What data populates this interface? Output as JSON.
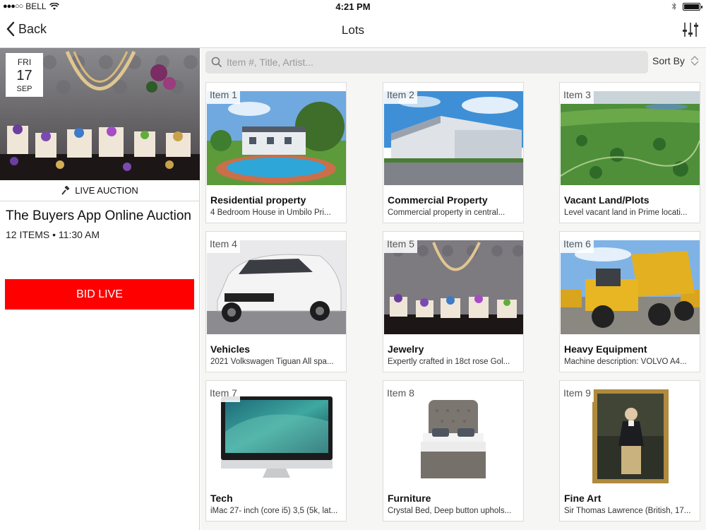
{
  "status": {
    "carrier": "BELL",
    "signal_dots": "●●●○○",
    "time": "4:21 PM"
  },
  "nav": {
    "back_label": "Back",
    "title": "Lots"
  },
  "auction": {
    "date": {
      "dow": "FRI",
      "day": "17",
      "month": "SEP"
    },
    "type_label": "LIVE AUCTION",
    "title": "The Buyers App Online Auction",
    "meta": "12 ITEMS • 11:30 AM",
    "bid_label": "BID LIVE"
  },
  "search": {
    "placeholder": "Item #, Title, Artist..."
  },
  "sort_label": "Sort By",
  "colors": {
    "accent": "#ff0000",
    "panel_bg": "#f6f6f4"
  },
  "lots": [
    {
      "tag": "Item 1",
      "title": "Residential property",
      "desc": "4 Bedroom House in Umbilo Pri..."
    },
    {
      "tag": "Item 2",
      "title": "Commercial Property",
      "desc": "Commercial property in central..."
    },
    {
      "tag": "Item 3",
      "title": "Vacant Land/Plots",
      "desc": "Level vacant land in Prime locati..."
    },
    {
      "tag": "Item 4",
      "title": "Vehicles",
      "desc": "2021 Volkswagen Tiguan All spa..."
    },
    {
      "tag": "Item 5",
      "title": "Jewelry",
      "desc": "Expertly crafted in 18ct rose Gol..."
    },
    {
      "tag": "Item 6",
      "title": "Heavy Equipment",
      "desc": "Machine description: VOLVO A4..."
    },
    {
      "tag": "Item 7",
      "title": "Tech",
      "desc": "iMac 27- inch (core i5) 3,5 (5k, lat..."
    },
    {
      "tag": "Item 8",
      "title": "Furniture",
      "desc": "Crystal Bed, Deep button uphols..."
    },
    {
      "tag": "Item 9",
      "title": "Fine Art",
      "desc": "Sir Thomas Lawrence (British, 17..."
    }
  ]
}
